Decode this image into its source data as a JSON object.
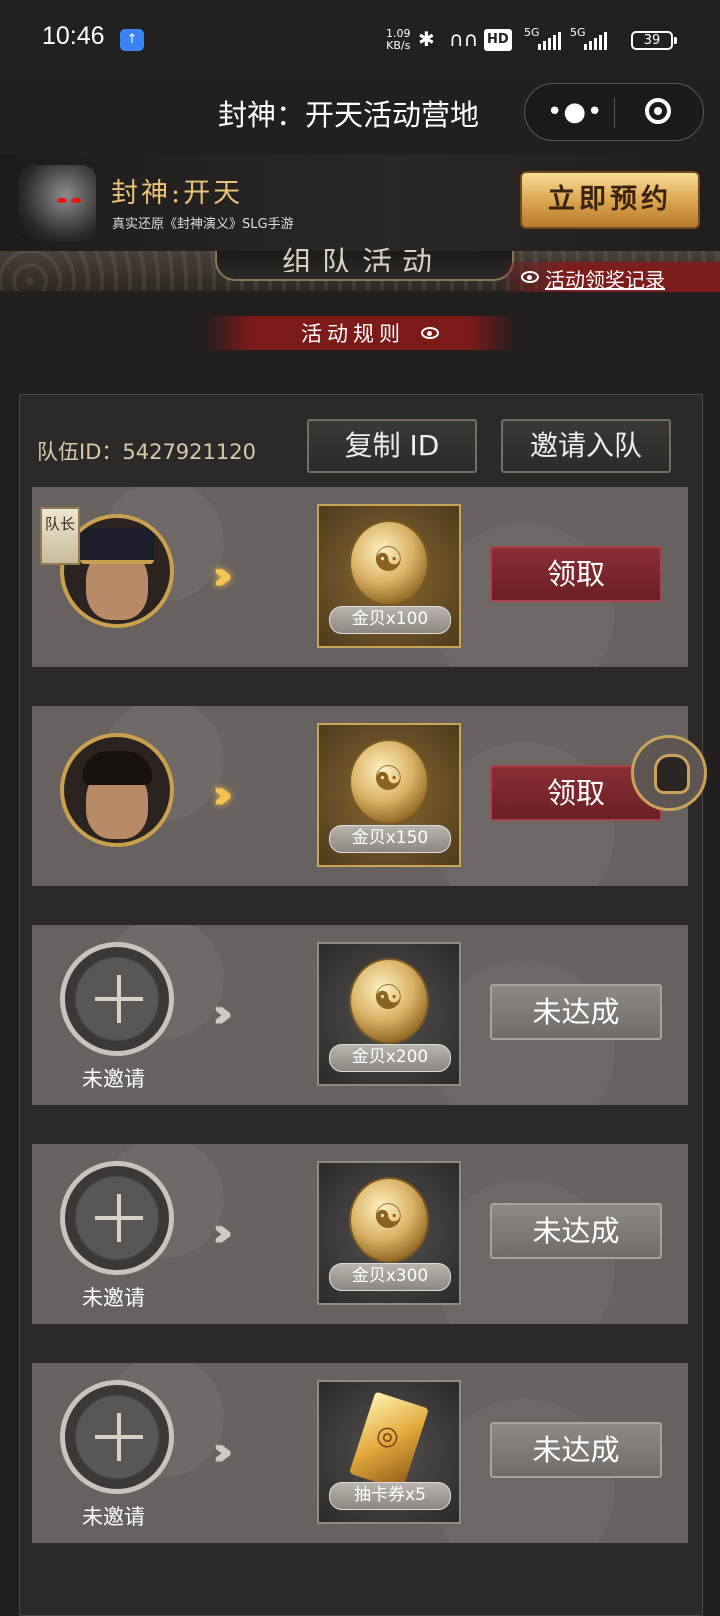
{
  "status_bar": {
    "time": "10:46",
    "net_speed_value": "1.09",
    "net_speed_unit": "KB/s",
    "hd_label": "HD",
    "signal_1": "5G",
    "signal_2": "5G",
    "battery": "39",
    "icons": [
      "mini-app-icon",
      "bluetooth-icon",
      "earbuds-icon",
      "hd-call-icon",
      "signal-icon",
      "battery-icon"
    ]
  },
  "title_bar": {
    "title": "封神：开天活动营地",
    "more_icon": "more-dots-icon",
    "close_icon": "target-close-icon"
  },
  "banner": {
    "game_name": "封神:开天",
    "subtitle": "真实还原《封神演义》SLG手游",
    "cta": "立即预约"
  },
  "section": {
    "title": "组队活动",
    "record_link": "活动领奖记录",
    "rules_link": "活动规则"
  },
  "team": {
    "id_label": "队伍ID：5427921120",
    "copy_button": "复制 ID",
    "invite_button": "邀请入队"
  },
  "rows": [
    {
      "member": "captain",
      "captain_badge": "队长",
      "reward": "金贝x100",
      "action": "领取",
      "state": "claim"
    },
    {
      "member": "member",
      "reward": "金贝x150",
      "action": "领取",
      "state": "claim"
    },
    {
      "member": "empty",
      "status": "未邀请",
      "reward": "金贝x200",
      "action": "未达成",
      "state": "locked"
    },
    {
      "member": "empty",
      "status": "未邀请",
      "reward": "金贝x300",
      "action": "未达成",
      "state": "locked"
    },
    {
      "member": "empty",
      "status": "未邀请",
      "reward": "抽卡券x5",
      "action": "未达成",
      "state": "locked"
    }
  ],
  "colors": {
    "background": "#221f1e",
    "gold_accent": "#c9a14e",
    "claim_button": "#7a2530",
    "locked_button": "#817c78"
  }
}
